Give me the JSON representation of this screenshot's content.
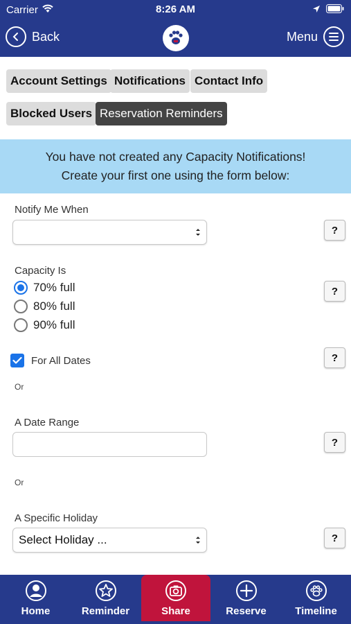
{
  "status": {
    "carrier": "Carrier",
    "time": "8:26 AM"
  },
  "nav": {
    "back_label": "Back",
    "menu_label": "Menu"
  },
  "tabs": [
    {
      "label": "Account Settings"
    },
    {
      "label": "Notifications"
    },
    {
      "label": "Contact Info"
    },
    {
      "label": "Blocked Users"
    },
    {
      "label": "Reservation Reminders"
    }
  ],
  "banner": {
    "line1": "You have not created any Capacity Notifications!",
    "line2": "Create your first one using the form below:"
  },
  "form": {
    "notify_label": "Notify Me When",
    "notify_value": "",
    "capacity_label": "Capacity Is",
    "capacity_options": [
      "70% full",
      "80% full",
      "90% full"
    ],
    "capacity_selected": "70% full",
    "all_dates_label": "For All Dates",
    "all_dates_checked": true,
    "or_text": "Or",
    "date_range_label": "A Date Range",
    "date_range_value": "",
    "holiday_label": "A Specific Holiday",
    "holiday_value": "Select Holiday ...",
    "help_text": "?"
  },
  "bottom_nav": [
    {
      "label": "Home",
      "icon": "user-circle-icon"
    },
    {
      "label": "Reminder",
      "icon": "star-circle-icon"
    },
    {
      "label": "Share",
      "icon": "camera-icon"
    },
    {
      "label": "Reserve",
      "icon": "plus-circle-icon"
    },
    {
      "label": "Timeline",
      "icon": "paw-circle-icon"
    }
  ],
  "colors": {
    "brand": "#263a8c",
    "banner": "#a8d9f5",
    "share": "#c0143c",
    "accent": "#1a73e8"
  }
}
